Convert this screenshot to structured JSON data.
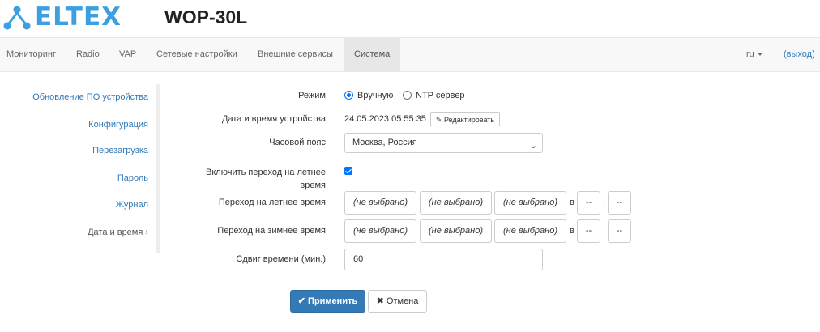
{
  "header": {
    "brand": "ELTEX",
    "model": "WOP-30L"
  },
  "nav": {
    "items": [
      "Мониторинг",
      "Radio",
      "VAP",
      "Сетевые настройки",
      "Внешние сервисы",
      "Система"
    ],
    "active": "Система",
    "lang": "ru",
    "logout": "(выход)"
  },
  "sidebar": {
    "items": [
      "Обновление ПО устройства",
      "Конфигурация",
      "Перезагрузка",
      "Пароль",
      "Журнал",
      "Дата и время"
    ],
    "active": "Дата и время"
  },
  "form": {
    "mode": {
      "label": "Режим",
      "options": [
        "Вручную",
        "NTP сервер"
      ],
      "selected": "Вручную"
    },
    "datetime": {
      "label": "Дата и время устройства",
      "value": "24.05.2023 05:55:35",
      "edit_button": "Редактировать"
    },
    "timezone": {
      "label": "Часовой пояс",
      "value": "Москва, Россия"
    },
    "dst_enable": {
      "label": "Включить переход на летнее время",
      "checked": true
    },
    "dst_start": {
      "label": "Переход на летнее время",
      "month": "(не выбрано)",
      "week": "(не выбрано)",
      "day": "(не выбрано)",
      "at": "в",
      "hour": "--",
      "colon": ":",
      "minute": "--"
    },
    "dst_end": {
      "label": "Переход на зимнее время",
      "month": "(не выбрано)",
      "week": "(не выбрано)",
      "day": "(не выбрано)",
      "at": "в",
      "hour": "--",
      "colon": ":",
      "minute": "--"
    },
    "offset": {
      "label": "Сдвиг времени (мин.)",
      "value": "60"
    }
  },
  "actions": {
    "apply": "Применить",
    "cancel": "Отмена"
  },
  "colors": {
    "brand": "#3b9fe0",
    "primary": "#337ab7",
    "link": "#337ab7",
    "check": "#0075ff"
  }
}
